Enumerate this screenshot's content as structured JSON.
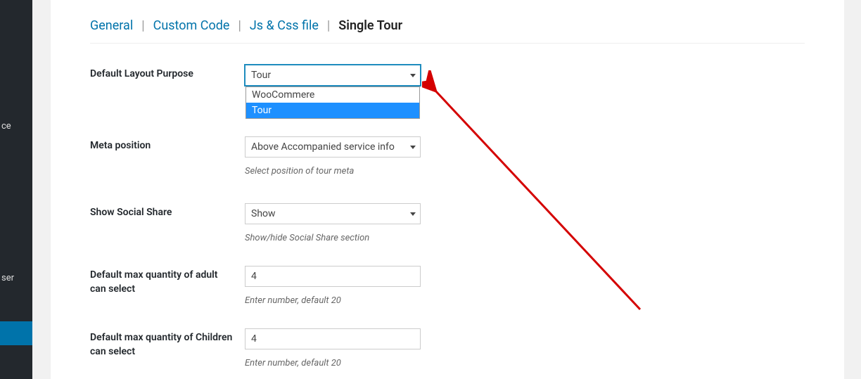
{
  "sidebar": {
    "items": [
      {
        "label": "ce"
      },
      {
        "label": "ser"
      }
    ]
  },
  "tabs": {
    "general": "General",
    "custom_code": "Custom Code",
    "js_css": "Js & Css file",
    "single_tour": "Single Tour"
  },
  "fields": {
    "layout": {
      "label": "Default Layout Purpose",
      "value": "Tour",
      "options": [
        "WooCommere",
        "Tour"
      ],
      "selected_index": 1
    },
    "meta_position": {
      "label": "Meta position",
      "value": "Above Accompanied service info",
      "helper": "Select position of tour meta"
    },
    "social": {
      "label": "Show Social Share",
      "value": "Show",
      "helper": "Show/hide Social Share section"
    },
    "max_adult": {
      "label": "Default max quantity of adult can select",
      "value": "4",
      "helper": "Enter number, default 20"
    },
    "max_children": {
      "label": "Default max quantity of Children can select",
      "value": "4",
      "helper": "Enter number, default 20"
    }
  }
}
